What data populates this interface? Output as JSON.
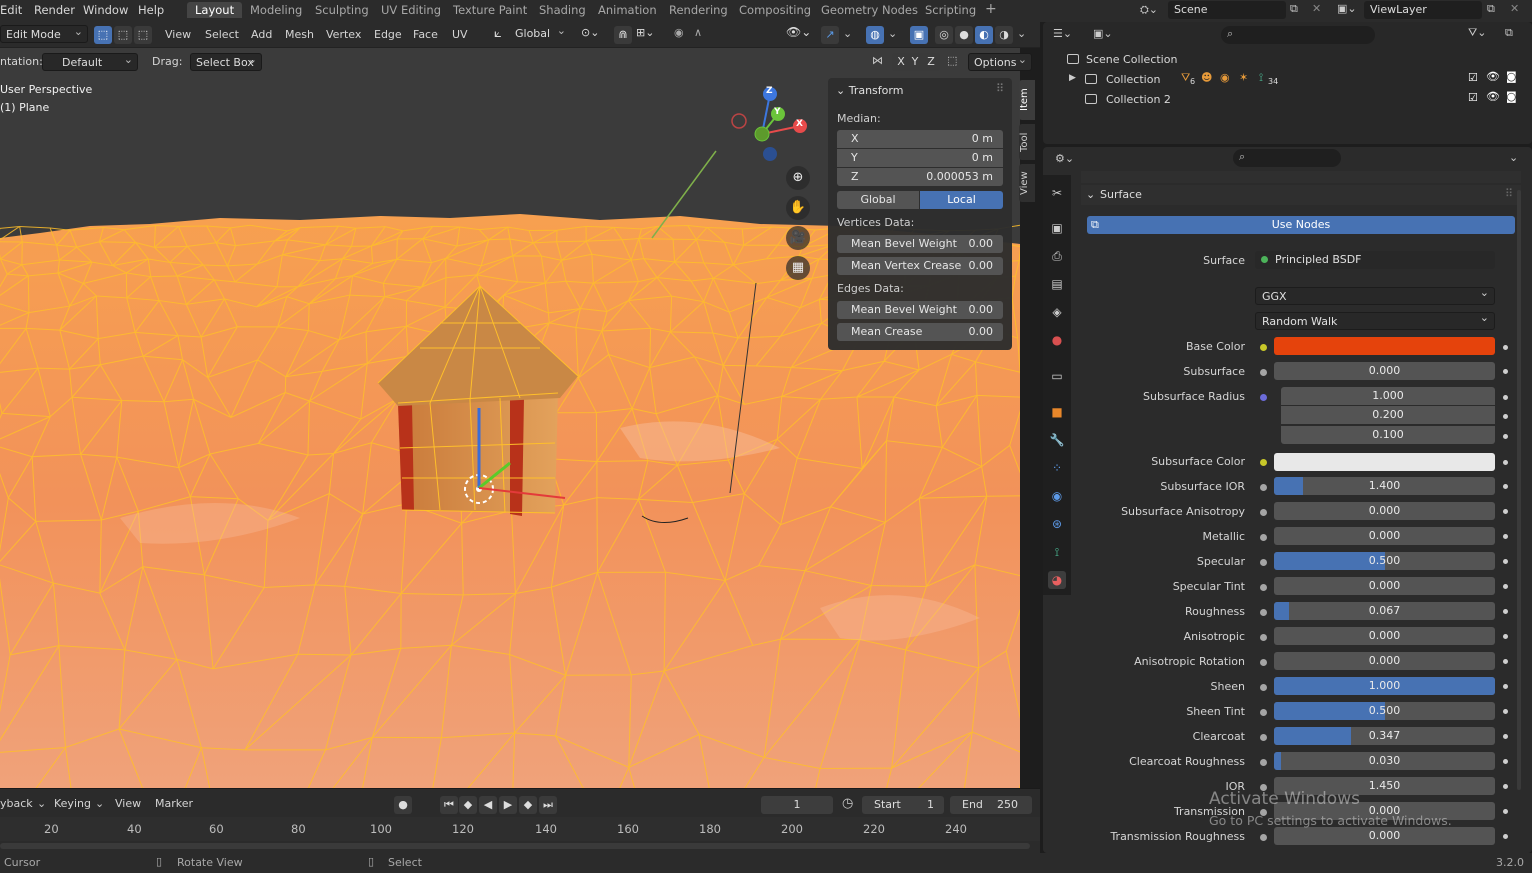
{
  "menus": [
    "Edit",
    "Render",
    "Window",
    "Help"
  ],
  "workspaces": [
    "Layout",
    "Modeling",
    "Sculpting",
    "UV Editing",
    "Texture Paint",
    "Shading",
    "Animation",
    "Rendering",
    "Compositing",
    "Geometry Nodes",
    "Scripting"
  ],
  "add_workspace": "+",
  "scene": {
    "name": "Scene",
    "view_layer": "ViewLayer"
  },
  "header": {
    "mode": "Edit Mode",
    "menus": [
      "View",
      "Select",
      "Add",
      "Mesh",
      "Vertex",
      "Edge",
      "Face",
      "UV"
    ],
    "orientation": "Global"
  },
  "tool_settings": {
    "orientation_label": "ntation:",
    "orientation_value": "Default",
    "drag_label": "Drag:",
    "drag_value": "Select Box",
    "axes": [
      "X",
      "Y",
      "Z"
    ],
    "options": "Options"
  },
  "viewport": {
    "view_name": "User Perspective",
    "object_name": "(1) Plane",
    "gizmo": {
      "x": "X",
      "y": "Y",
      "z": "Z"
    }
  },
  "npanel": {
    "title": "Transform",
    "median_label": "Median:",
    "fields": [
      {
        "key": "X",
        "value": "0 m"
      },
      {
        "key": "Y",
        "value": "0 m"
      },
      {
        "key": "Z",
        "value": "0.000053 m"
      }
    ],
    "space_global": "Global",
    "space_local": "Local",
    "vertices_label": "Vertices Data:",
    "vertex_fields": [
      {
        "key": "Mean Bevel Weight",
        "value": "0.00"
      },
      {
        "key": "Mean Vertex Crease",
        "value": "0.00"
      }
    ],
    "edges_label": "Edges Data:",
    "edge_fields": [
      {
        "key": "Mean Bevel Weight",
        "value": "0.00"
      },
      {
        "key": "Mean Crease",
        "value": "0.00"
      }
    ],
    "tabs": [
      "Item",
      "Tool",
      "View"
    ]
  },
  "timeline": {
    "menus": [
      "yback",
      "Keying",
      "View",
      "Marker"
    ],
    "current_frame": "1",
    "start_label": "Start",
    "start": "1",
    "end_label": "End",
    "end": "250",
    "ruler": [
      "20",
      "40",
      "60",
      "80",
      "100",
      "120",
      "140",
      "160",
      "180",
      "200",
      "220",
      "240"
    ]
  },
  "statusbar": {
    "left": "Cursor",
    "middle": "Rotate View",
    "right": "Select",
    "version": "3.2.0"
  },
  "outliner": {
    "root": "Scene Collection",
    "items": [
      "Collection",
      "Collection 2"
    ],
    "counts": [
      "6",
      "34"
    ]
  },
  "properties": {
    "section": "Surface",
    "use_nodes": "Use Nodes",
    "surface_label": "Surface",
    "surface_value": "Principled BSDF",
    "distribution": "GGX",
    "subsurface_method": "Random Walk",
    "base_color_label": "Base Color",
    "base_color": "#e5430c",
    "subsurface_color_label": "Subsurface Color",
    "subsurface_color": "#e8e8e8",
    "subsurface_radius_label": "Subsurface Radius",
    "subsurface_radius": [
      "1.000",
      "0.200",
      "0.100"
    ],
    "params": [
      {
        "label": "Subsurface",
        "value": "0.000",
        "fill": 0
      },
      {
        "label": "Subsurface IOR",
        "value": "1.400",
        "fill": 0.13
      },
      {
        "label": "Subsurface Anisotropy",
        "value": "0.000",
        "fill": 0
      },
      {
        "label": "Metallic",
        "value": "0.000",
        "fill": 0
      },
      {
        "label": "Specular",
        "value": "0.500",
        "fill": 0.5
      },
      {
        "label": "Specular Tint",
        "value": "0.000",
        "fill": 0
      },
      {
        "label": "Roughness",
        "value": "0.067",
        "fill": 0.067
      },
      {
        "label": "Anisotropic",
        "value": "0.000",
        "fill": 0
      },
      {
        "label": "Anisotropic Rotation",
        "value": "0.000",
        "fill": 0
      },
      {
        "label": "Sheen",
        "value": "1.000",
        "fill": 1
      },
      {
        "label": "Sheen Tint",
        "value": "0.500",
        "fill": 0.5
      },
      {
        "label": "Clearcoat",
        "value": "0.347",
        "fill": 0.347
      },
      {
        "label": "Clearcoat Roughness",
        "value": "0.030",
        "fill": 0.03
      },
      {
        "label": "IOR",
        "value": "1.450",
        "fill": 0
      },
      {
        "label": "Transmission",
        "value": "0.000",
        "fill": 0
      },
      {
        "label": "Transmission Roughness",
        "value": "0.000",
        "fill": 0
      }
    ]
  },
  "watermark": {
    "title": "Activate Windows",
    "subtitle": "Go to PC settings to activate Windows."
  },
  "colors": {
    "accent": "#4772b3",
    "mesh_edge": "#ffb300",
    "ground": "#f0925a"
  }
}
